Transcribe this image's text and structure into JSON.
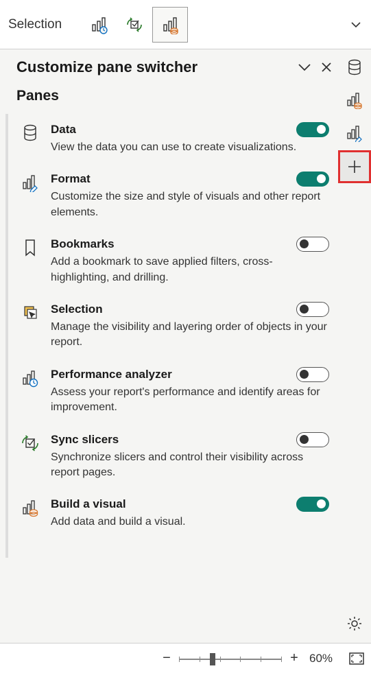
{
  "topbar": {
    "label": "Selection"
  },
  "panel": {
    "title": "Customize pane switcher",
    "section": "Panes",
    "items": [
      {
        "name": "Data",
        "desc": "View the data you can use to create visualizations.",
        "on": true
      },
      {
        "name": "Format",
        "desc": "Customize the size and style of visuals and other report elements.",
        "on": true
      },
      {
        "name": "Bookmarks",
        "desc": "Add a bookmark to save applied filters, cross-highlighting, and drilling.",
        "on": false
      },
      {
        "name": "Selection",
        "desc": "Manage the visibility and layering order of objects in your report.",
        "on": false
      },
      {
        "name": "Performance analyzer",
        "desc": "Assess your report's performance and identify areas for improvement.",
        "on": false
      },
      {
        "name": "Sync slicers",
        "desc": "Synchronize slicers and control their visibility across report pages.",
        "on": false
      },
      {
        "name": "Build a visual",
        "desc": "Add data and build a visual.",
        "on": true
      }
    ]
  },
  "zoom": {
    "level": "60%"
  }
}
